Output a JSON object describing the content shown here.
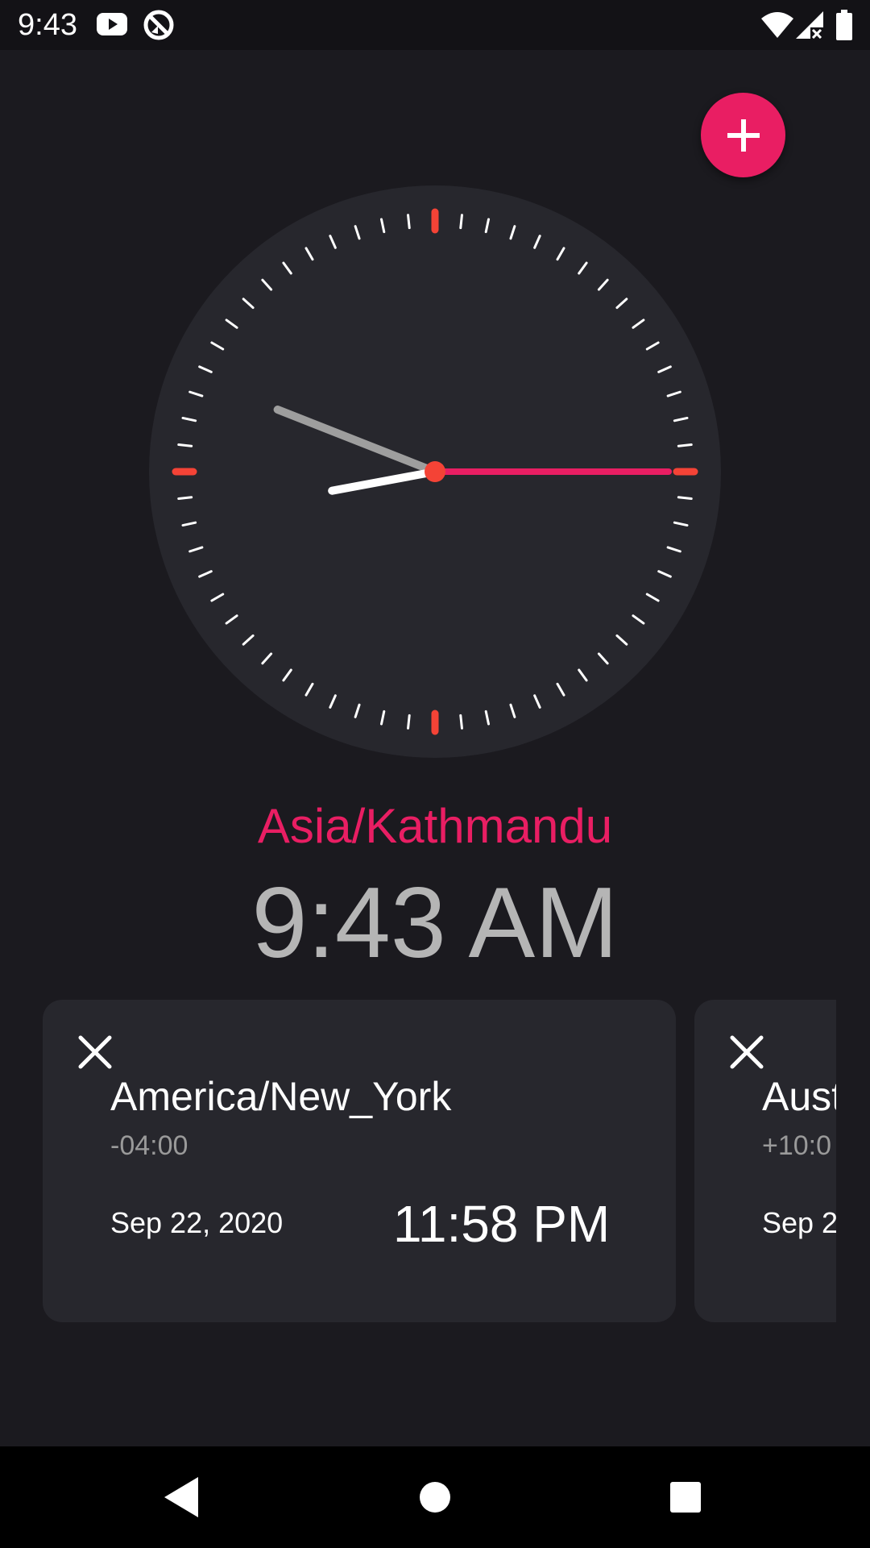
{
  "status_bar": {
    "time": "9:43",
    "icons": [
      "youtube-icon",
      "sync-disabled-icon",
      "wifi-icon",
      "cellular-signal-icon",
      "battery-icon"
    ]
  },
  "fab": {
    "icon": "plus-icon"
  },
  "clock": {
    "hours": 9,
    "minutes": 43,
    "seconds": 15,
    "accent_color": "#e91e63",
    "marker_color": "#f44336",
    "face_color": "#27272d"
  },
  "main_zone": {
    "name": "Asia/Kathmandu",
    "time": "9:43 AM"
  },
  "cards": [
    {
      "city": "America/New_York",
      "offset": "-04:00",
      "date": "Sep 22, 2020",
      "time": "11:58 PM"
    },
    {
      "city": "Aust",
      "offset": "+10:0",
      "date": "Sep 2",
      "time": ""
    }
  ],
  "nav_bar": {
    "icons": [
      "back-icon",
      "home-icon",
      "recents-icon"
    ]
  }
}
